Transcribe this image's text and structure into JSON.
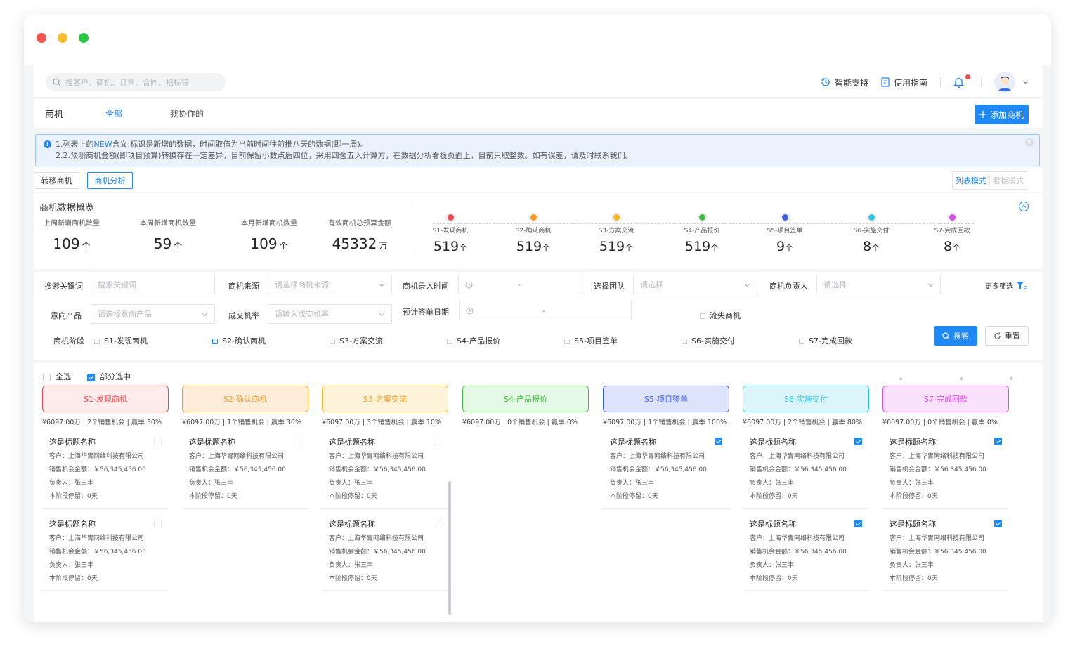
{
  "window": {
    "dots": [
      "#f5554f",
      "#fbbd2e",
      "#28c840"
    ]
  },
  "topbar": {
    "search_placeholder": "搜客户、商机、订单、合同、招标等",
    "support": "智能支持",
    "guide": "使用指南"
  },
  "tabs": {
    "title": "商机",
    "all": "全部",
    "collab": "我协作的",
    "add": "添加商机"
  },
  "notice": {
    "line1_pre": "1.列表上的",
    "line1_new": "NEW",
    "line1_post": "含义:标识是新增的数据，时间取值为当前时间往前推八天的数据(即一周)。",
    "line2": "2.2.预测商机金额(即项目预算)转换存在一定差异，目前保留小数点后四位，采用四舍五入计算方，在数据分析看板页面上，目前只取整数。如有误差，请及时联系我们。"
  },
  "actions": {
    "transfer": "转移商机",
    "analysis": "商机分析",
    "list_mode": "列表模式",
    "board_mode": "看板模式"
  },
  "overview": {
    "title": "商机数据概览",
    "stats": [
      {
        "label": "上周新增商机数量",
        "value": "109",
        "unit": "个"
      },
      {
        "label": "本周新增商机数量",
        "value": "59",
        "unit": "个"
      },
      {
        "label": "本月新增商机数量",
        "value": "109",
        "unit": "个"
      },
      {
        "label": "有效商机总预算金额",
        "value": "45332",
        "unit": "万"
      }
    ],
    "stages": [
      {
        "label": "S1-发现商机",
        "value": "519",
        "unit": "个",
        "color": "#f5484c"
      },
      {
        "label": "S2-确认商机",
        "value": "519",
        "unit": "个",
        "color": "#fa9a1e"
      },
      {
        "label": "S3-方案交流",
        "value": "519",
        "unit": "个",
        "color": "#fab81e"
      },
      {
        "label": "S4-产品报价",
        "value": "519",
        "unit": "个",
        "color": "#3fbf42"
      },
      {
        "label": "S5-项目签单",
        "value": "9",
        "unit": "个",
        "color": "#3d5ee8"
      },
      {
        "label": "S6-实施交付",
        "value": "8",
        "unit": "个",
        "color": "#2ec8e6"
      },
      {
        "label": "S7-完成回款",
        "value": "8",
        "unit": "个",
        "color": "#d94ee8"
      }
    ]
  },
  "filters": {
    "keyword_label": "搜索关键词",
    "keyword_ph": "搜索关键词",
    "source_label": "商机来源",
    "source_ph": "请选择商机来源",
    "time_label": "商机录入时间",
    "time_sep": "-",
    "team_label": "选择团队",
    "team_ph": "请选择",
    "owner_label": "商机负责人",
    "owner_ph": "请选择",
    "more": "更多筛选",
    "product_label": "意向产品",
    "product_ph": "请选择意向产品",
    "rate_label": "成交机率",
    "rate_ph": "请输入成交机率",
    "sign_label": "预计签单日期",
    "sign_sep": "-",
    "lost": "流失商机",
    "stage_label": "商机阶段",
    "stage_opts": [
      "S1-发现商机",
      "S2-确认商机",
      "S3-方案交流",
      "S4-产品报价",
      "S5-项目签单",
      "S6-实施交付",
      "S7-完成回款"
    ],
    "search_btn": "搜索",
    "reset_btn": "重置"
  },
  "kanban": {
    "select_all": "全选",
    "partial": "部分选中",
    "columns": [
      {
        "title": "S1-发现商机",
        "info": "¥6097.00万 | 2个销售机会 | 赢率 30%",
        "color": "#f5484c",
        "bg": "#feecec"
      },
      {
        "title": "S2-确认商机",
        "info": "¥6097.00万 | 1个销售机会 | 赢率 30%",
        "color": "#fa9a1e",
        "bg": "#feedd9"
      },
      {
        "title": "S3-方案交流",
        "info": "¥6097.00万 | 3个销售机会 | 赢率 10%",
        "color": "#fab81e",
        "bg": "#fff3d9"
      },
      {
        "title": "S4-产品报价",
        "info": "¥6097.00万 | 0个销售机会 | 赢率 0%",
        "color": "#3fbf42",
        "bg": "#e6f8e6"
      },
      {
        "title": "S5-项目签单",
        "info": "¥6097.00万 | 1个销售机会 | 赢率 100%",
        "color": "#3d5ee8",
        "bg": "#dce3fb"
      },
      {
        "title": "S6-实施交付",
        "info": "¥6097.00万 | 2个销售机会 | 赢率 80%",
        "color": "#2ec8e6",
        "bg": "#dbf5fb"
      },
      {
        "title": "S7-完成回款",
        "info": "¥6097.00万 | 0个销售机会 | 赢率 0%",
        "color": "#d94ee8",
        "bg": "#f9e2fc"
      }
    ],
    "card": {
      "title": "这是标题名称",
      "customer": "客户：上海华胄网络科技有限公司",
      "amount": "销售机会金额：￥56,345,456.00",
      "owner": "负责人：张三丰",
      "stay": "本阶段停留：0天"
    }
  }
}
